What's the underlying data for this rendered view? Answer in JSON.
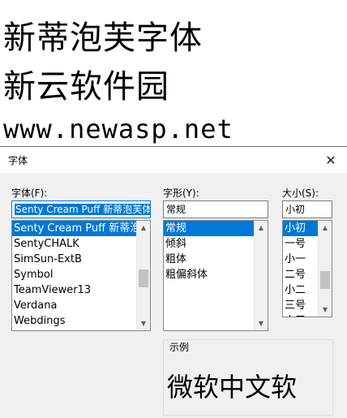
{
  "banner": {
    "line1": "新蒂泡芙字体",
    "line2": "新云软件园",
    "line3": "www.newasp.net"
  },
  "dialog": {
    "title": "字体",
    "font": {
      "label": "字体(F):",
      "value": "Senty Cream Puff 新蒂泡芙体",
      "items": [
        "Senty Cream Puff 新蒂泡",
        "SentyCHALK",
        "SimSun-ExtB",
        "Symbol",
        "TeamViewer13",
        "Verdana",
        "Webdings"
      ],
      "selected_index": 0
    },
    "style": {
      "label": "字形(Y):",
      "value": "常规",
      "items": [
        "常规",
        "倾斜",
        "粗体",
        "粗偏斜体"
      ],
      "selected_index": 0
    },
    "size": {
      "label": "大小(S):",
      "value": "小初",
      "items": [
        "小初",
        "一号",
        "小一",
        "二号",
        "小二",
        "三号",
        "小三"
      ],
      "selected_index": 0
    },
    "sample": {
      "label": "示例",
      "text": "微软中文软"
    }
  },
  "colors": {
    "accent": "#0078d7",
    "dialog_bg": "#f0f0f0"
  }
}
